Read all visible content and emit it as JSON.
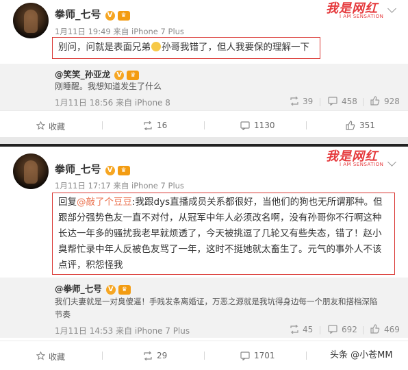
{
  "post1": {
    "author": "拳师_七号",
    "meta": "1月11日 19:49 来自 iPhone 7 Plus",
    "text_before": "别问，问就是表面兄弟",
    "text_after": "孙哥我错了，但人我要保的理解一下",
    "watermark": "我是网红",
    "watermark_sub": "I AM SENSATION",
    "retweet": {
      "author": "@笑笑_孙亚龙",
      "text": "刚睡醒。我想知道发生了什么",
      "meta": "1月11日 18:56 来自 iPhone 8",
      "reposts": "39",
      "comments": "458",
      "likes": "928"
    },
    "actions": {
      "favorite": "收藏",
      "reposts": "16",
      "comments": "1130",
      "likes": "351"
    }
  },
  "post2": {
    "author": "拳师_七号",
    "meta": "1月11日 17:17 来自 iPhone 7 Plus",
    "reply_prefix": "回复",
    "mention": "@敲了个豆豆",
    "lines": [
      ":我跟dys直播成员关系都很好，当他们的狗也无所谓那种。但",
      "跟部分强势色友一直不对付，从冠军中年人必须改名啊，没有孙哥你不行啊这种",
      "长达一年多的骚扰我老早就烦透了，今天被挑逗了几轮又有些失态，错了！赵小",
      "臭帮忙录中年人反被色友骂了一年，这时不挺她就太畜生了。元气的事外人不该",
      "点评，积怨怪我"
    ],
    "watermark": "我是网红",
    "watermark_sub": "I AM SENSATION",
    "retweet": {
      "author": "@拳师_七号",
      "line1": "我们夫妻就是一对臭傻逼！手贱发条离婚证，万恶之源就是我坑得身边每一个朋友和搭档深陷",
      "line2": "节奏",
      "meta": "1月11日 14:53 来自 iPhone 7 Plus",
      "reposts": "45",
      "comments": "692",
      "likes": "469"
    },
    "actions": {
      "favorite": "收藏",
      "reposts": "29",
      "comments": "1701"
    }
  },
  "source_watermark": "头条 @小苍MM",
  "colors": {
    "accent": "#eb7350",
    "highlight_border": "#d9332f",
    "brand_red": "#e5393c"
  }
}
